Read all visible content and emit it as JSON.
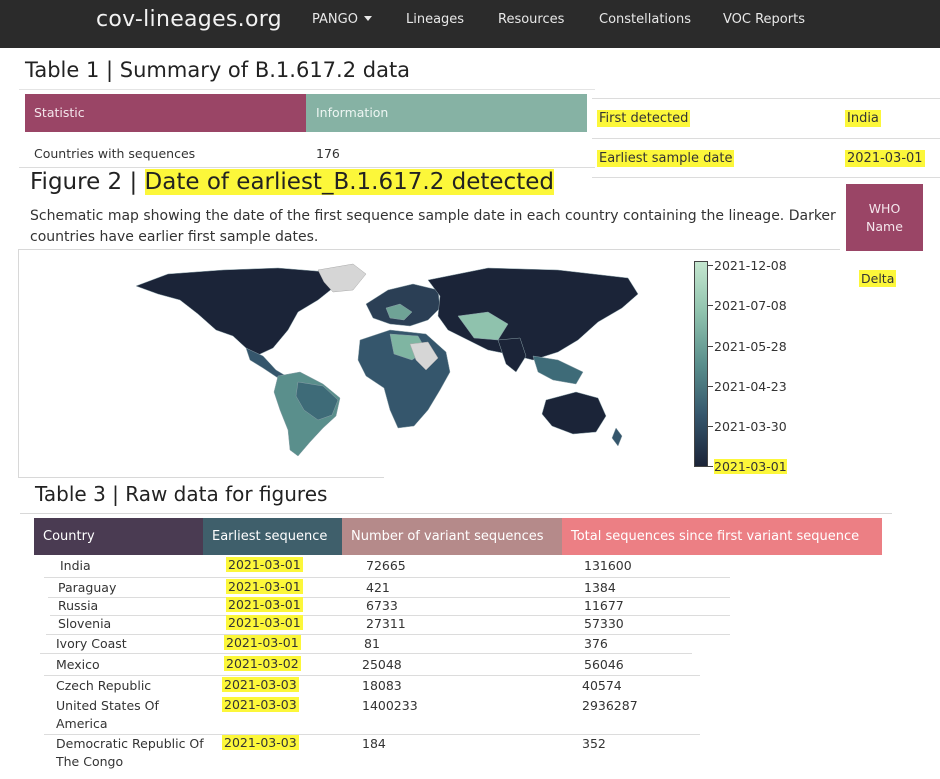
{
  "nav": {
    "brand": "cov-lineages.org",
    "items": [
      "PANGO",
      "Lineages",
      "Resources",
      "Constellations",
      "VOC Reports"
    ]
  },
  "table1": {
    "title": "Table 1 | Summary of B.1.617.2 data",
    "headers": [
      "Statistic",
      "Information"
    ],
    "rows": [
      [
        "Countries with sequences",
        "176"
      ]
    ]
  },
  "summary": {
    "first_detected_label": "First detected",
    "first_detected_value": "India",
    "earliest_label": "Earliest sample date",
    "earliest_value": "2021-03-01",
    "who_label_line1": "WHO",
    "who_label_line2": "Name",
    "who_value": "Delta"
  },
  "figure2": {
    "title_prefix": "Figure 2 |",
    "title_highlight": "Date of earliest_B.1.617.2 detected",
    "description": "Schematic map showing the date of the first sequence sample date in each country containing the lineage. Darker countries have earlier first sample dates.",
    "colorbar": {
      "labels": [
        "2021-12-08",
        "2021-07-08",
        "2021-05-28",
        "2021-04-23",
        "2021-03-30",
        "2021-03-01"
      ],
      "colors": [
        "#c4e6cf",
        "#8fc2ad",
        "#5a8f8c",
        "#35566c",
        "#1b2438"
      ]
    }
  },
  "table3": {
    "title": "Table 3 | Raw data for figures",
    "headers": [
      "Country",
      "Earliest sequence",
      "Number of variant sequences",
      "Total sequences since first variant sequence"
    ],
    "header_colors": [
      "#4a3b52",
      "#3f5f6b",
      "#b58a8a",
      "#ec7f84"
    ],
    "rows": [
      {
        "country": "India",
        "date": "2021-03-01",
        "variant": "72665",
        "total": "131600"
      },
      {
        "country": "Paraguay",
        "date": "2021-03-01",
        "variant": "421",
        "total": "1384"
      },
      {
        "country": "Russia",
        "date": "2021-03-01",
        "variant": "6733",
        "total": "11677"
      },
      {
        "country": "Slovenia",
        "date": "2021-03-01",
        "variant": "27311",
        "total": "57330"
      },
      {
        "country": "Ivory Coast",
        "date": "2021-03-01",
        "variant": "81",
        "total": "376"
      },
      {
        "country": "Mexico",
        "date": "2021-03-02",
        "variant": "25048",
        "total": "56046"
      },
      {
        "country": "Czech Republic",
        "date": "2021-03-03",
        "variant": "18083",
        "total": "40574"
      },
      {
        "country": "United States Of America",
        "date": "2021-03-03",
        "variant": "1400233",
        "total": "2936287"
      },
      {
        "country": "Democratic Republic Of The Congo",
        "date": "2021-03-03",
        "variant": "184",
        "total": "352"
      }
    ]
  }
}
